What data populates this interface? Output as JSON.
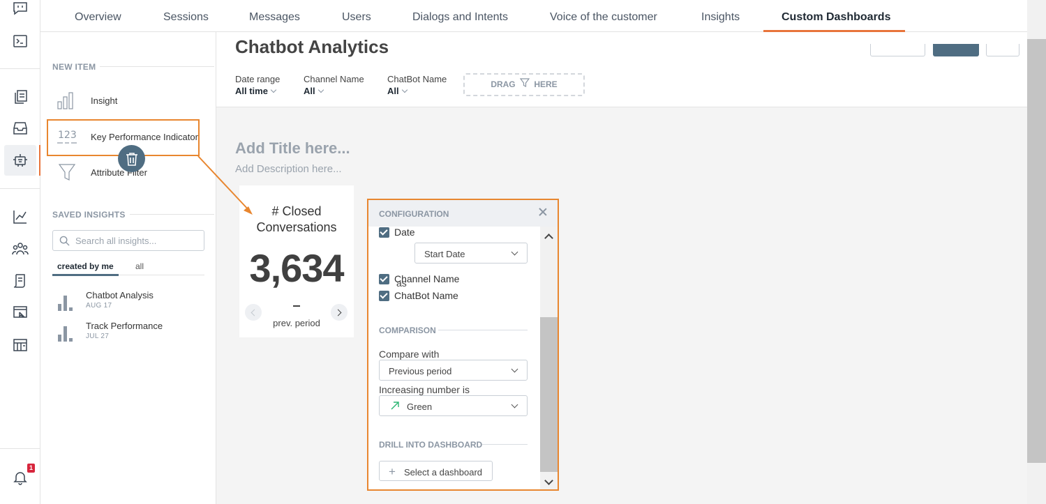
{
  "top_tabs": [
    {
      "label": "Overview"
    },
    {
      "label": "Sessions"
    },
    {
      "label": "Messages"
    },
    {
      "label": "Users"
    },
    {
      "label": "Dialogs and Intents"
    },
    {
      "label": "Voice of the customer"
    },
    {
      "label": "Insights"
    },
    {
      "label": "Custom Dashboards",
      "active": true
    }
  ],
  "rail": {
    "icons": [
      "chat-icon",
      "terminal-icon",
      "copy-pages-icon",
      "inbox-icon",
      "robot-icon",
      "line-chart-icon",
      "users-group-icon",
      "scroll-icon",
      "board-cursor-icon",
      "storefront-icon",
      "bell-icon"
    ],
    "notification_count": "1"
  },
  "left_panel": {
    "new_item_heading": "NEW ITEM",
    "new_items": [
      {
        "label": "Insight",
        "icon": "bar-chart-icon"
      },
      {
        "label": "Key Performance Indicator",
        "icon": "kpi-123-icon"
      },
      {
        "label": "Attribute Filter",
        "icon": "funnel-icon"
      }
    ],
    "saved_heading": "SAVED INSIGHTS",
    "search_placeholder": "Search all insights...",
    "filter_tabs": {
      "mine": "created by me",
      "all": "all"
    },
    "saved": [
      {
        "name": "Chatbot Analysis",
        "date": "AUG 17"
      },
      {
        "name": "Track Performance",
        "date": "JUL 27"
      }
    ]
  },
  "dashboard": {
    "title": "Chatbot Analytics",
    "filters": [
      {
        "label": "Date range",
        "value": "All time"
      },
      {
        "label": "Channel Name",
        "value": "All"
      },
      {
        "label": "ChatBot Name",
        "value": "All"
      }
    ],
    "dropzone": {
      "before": "DRAG",
      "after": "HERE"
    },
    "add_title": "Add Title here...",
    "add_description": "Add Description here..."
  },
  "kpi_card": {
    "title": "# Closed Conversations",
    "value": "3,634",
    "comparison_value": "–",
    "comparison_label": "prev. period"
  },
  "configuration": {
    "heading": "CONFIGURATION",
    "date_checkbox": "Date",
    "as_label": "as",
    "date_as_value": "Start Date",
    "channel_checkbox": "Channel Name",
    "chatbot_checkbox": "ChatBot Name",
    "comparison_heading": "COMPARISON",
    "compare_with_label": "Compare with",
    "compare_with_value": "Previous period",
    "increasing_label": "Increasing number is",
    "increasing_value": "Green",
    "drill_heading": "DRILL INTO DASHBOARD",
    "select_dashboard": "Select a dashboard"
  },
  "colors": {
    "accent": "#e8743b",
    "highlight": "#e8862f",
    "slate": "#4f6d82",
    "positive": "#2bb673"
  }
}
